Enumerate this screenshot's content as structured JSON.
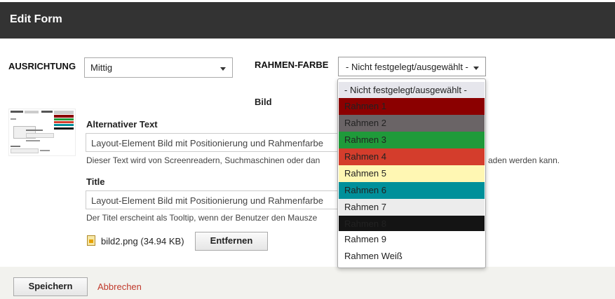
{
  "header": {
    "title": "Edit Form"
  },
  "ausrichtung": {
    "label": "AUSRICHTUNG",
    "value": "Mittig"
  },
  "rahmen_farbe": {
    "label": "RAHMEN-FARBE",
    "value": "- Nicht festgelegt/ausgewählt -",
    "options": [
      {
        "label": "- Nicht festgelegt/ausgewählt -",
        "color": "#e6e6ec",
        "text_color": "#222222"
      },
      {
        "label": "Rahmen 1",
        "color": "#8b0000",
        "text_color": "#222222"
      },
      {
        "label": "Rahmen 2",
        "color": "#6a6466",
        "text_color": "#222222"
      },
      {
        "label": "Rahmen 3",
        "color": "#1f9a3a",
        "text_color": "#222222"
      },
      {
        "label": "Rahmen 4",
        "color": "#d43d2c",
        "text_color": "#222222"
      },
      {
        "label": "Rahmen 5",
        "color": "#fff7b3",
        "text_color": "#222222"
      },
      {
        "label": "Rahmen 6",
        "color": "#00909a",
        "text_color": "#222222"
      },
      {
        "label": "Rahmen 7",
        "color": "#ececec",
        "text_color": "#222222"
      },
      {
        "label": "Rahmen 8",
        "color": "#141414",
        "text_color": "#222222"
      },
      {
        "label": "Rahmen 9",
        "color": "#ffffff",
        "text_color": "#222222"
      },
      {
        "label": "Rahmen Weiß",
        "color": "#ffffff",
        "text_color": "#222222"
      }
    ]
  },
  "bild": {
    "label": "Bild"
  },
  "alt_text": {
    "label": "Alternativer Text",
    "value": "Layout-Element Bild mit Positionierung und Rahmenfarbe",
    "help": "Dieser Text wird von Screenreadern, Suchmaschinen oder dan",
    "help_tail": "aden werden kann."
  },
  "title_field": {
    "label": "Title",
    "value": "Layout-Element Bild mit Positionierung und Rahmenfarbe",
    "help": "Der Titel erscheint als Tooltip, wenn der Benutzer den Mausze"
  },
  "file": {
    "name": "bild2.png (34.94 KB)",
    "remove_label": "Entfernen",
    "icon": "image-file-icon"
  },
  "footer": {
    "save_label": "Speichern",
    "cancel_label": "Abbrechen"
  }
}
